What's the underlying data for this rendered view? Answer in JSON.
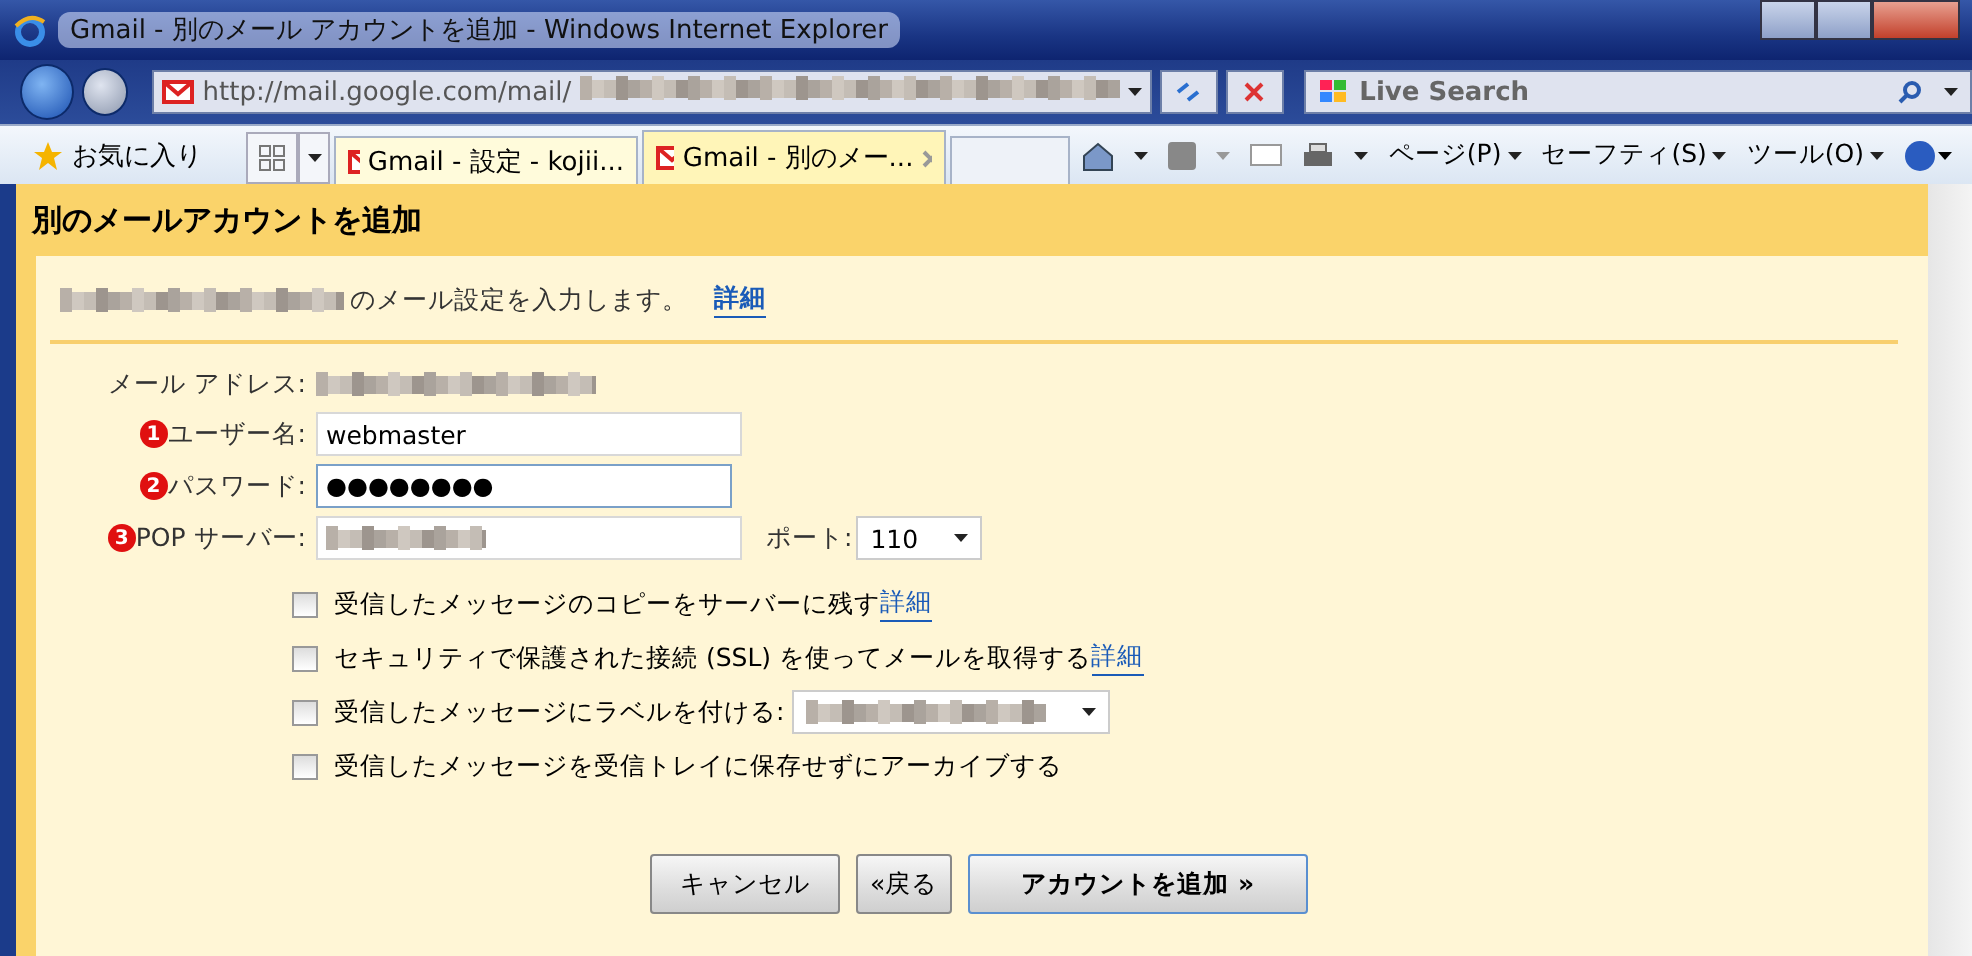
{
  "window": {
    "title": "Gmail - 別のメール アカウントを追加 - Windows Internet Explorer"
  },
  "address_bar": {
    "url": "http://mail.google.com/mail/",
    "url_blurred": true,
    "search_placeholder": "Live Search"
  },
  "favorites": {
    "label": "お気に入り"
  },
  "tabs": [
    {
      "label": "Gmail - 設定 - kojii...",
      "selected": false
    },
    {
      "label": "Gmail - 別のメー...",
      "selected": true
    }
  ],
  "command_bar": [
    {
      "label": "ページ(P)"
    },
    {
      "label": "セーフティ(S)"
    },
    {
      "label": "ツール(O)"
    }
  ],
  "page": {
    "heading": "別のメールアカウントを追加",
    "intro": "のメール設定を入力します。",
    "intro_blurred": true,
    "intro_link": "詳細",
    "fields": [
      {
        "kind": "static",
        "label": "メール アドレス:",
        "value_blurred": true
      },
      {
        "kind": "text",
        "marker": "1",
        "label": "ユーザー名:",
        "value": "webmaster"
      },
      {
        "kind": "password",
        "marker": "2",
        "label": "パスワード:",
        "value": "●●●●●●●●"
      },
      {
        "kind": "text",
        "marker": "3",
        "label": "POP サーバー:",
        "value_blurred": true
      }
    ],
    "port": {
      "label": "ポート:",
      "value": "110"
    },
    "options": [
      {
        "kind": "link",
        "label": "受信したメッセージのコピーをサーバーに残す",
        "link": "詳細",
        "checked": false
      },
      {
        "kind": "link",
        "label": "セキュリティで保護された接続 (SSL) を使ってメールを取得する",
        "link": "詳細",
        "checked": false
      },
      {
        "kind": "select",
        "label": "受信したメッセージにラベルを付ける:",
        "value_blurred": true,
        "checked": false
      },
      {
        "kind": "plain",
        "label": "受信したメッセージを受信トレイに保存せずにアーカイブする",
        "checked": false
      }
    ],
    "buttons": [
      {
        "label": "キャンセル",
        "kind": "normal"
      },
      {
        "label": "«戻る",
        "kind": "normal"
      },
      {
        "label": "アカウントを追加 »",
        "kind": "primary"
      }
    ]
  }
}
